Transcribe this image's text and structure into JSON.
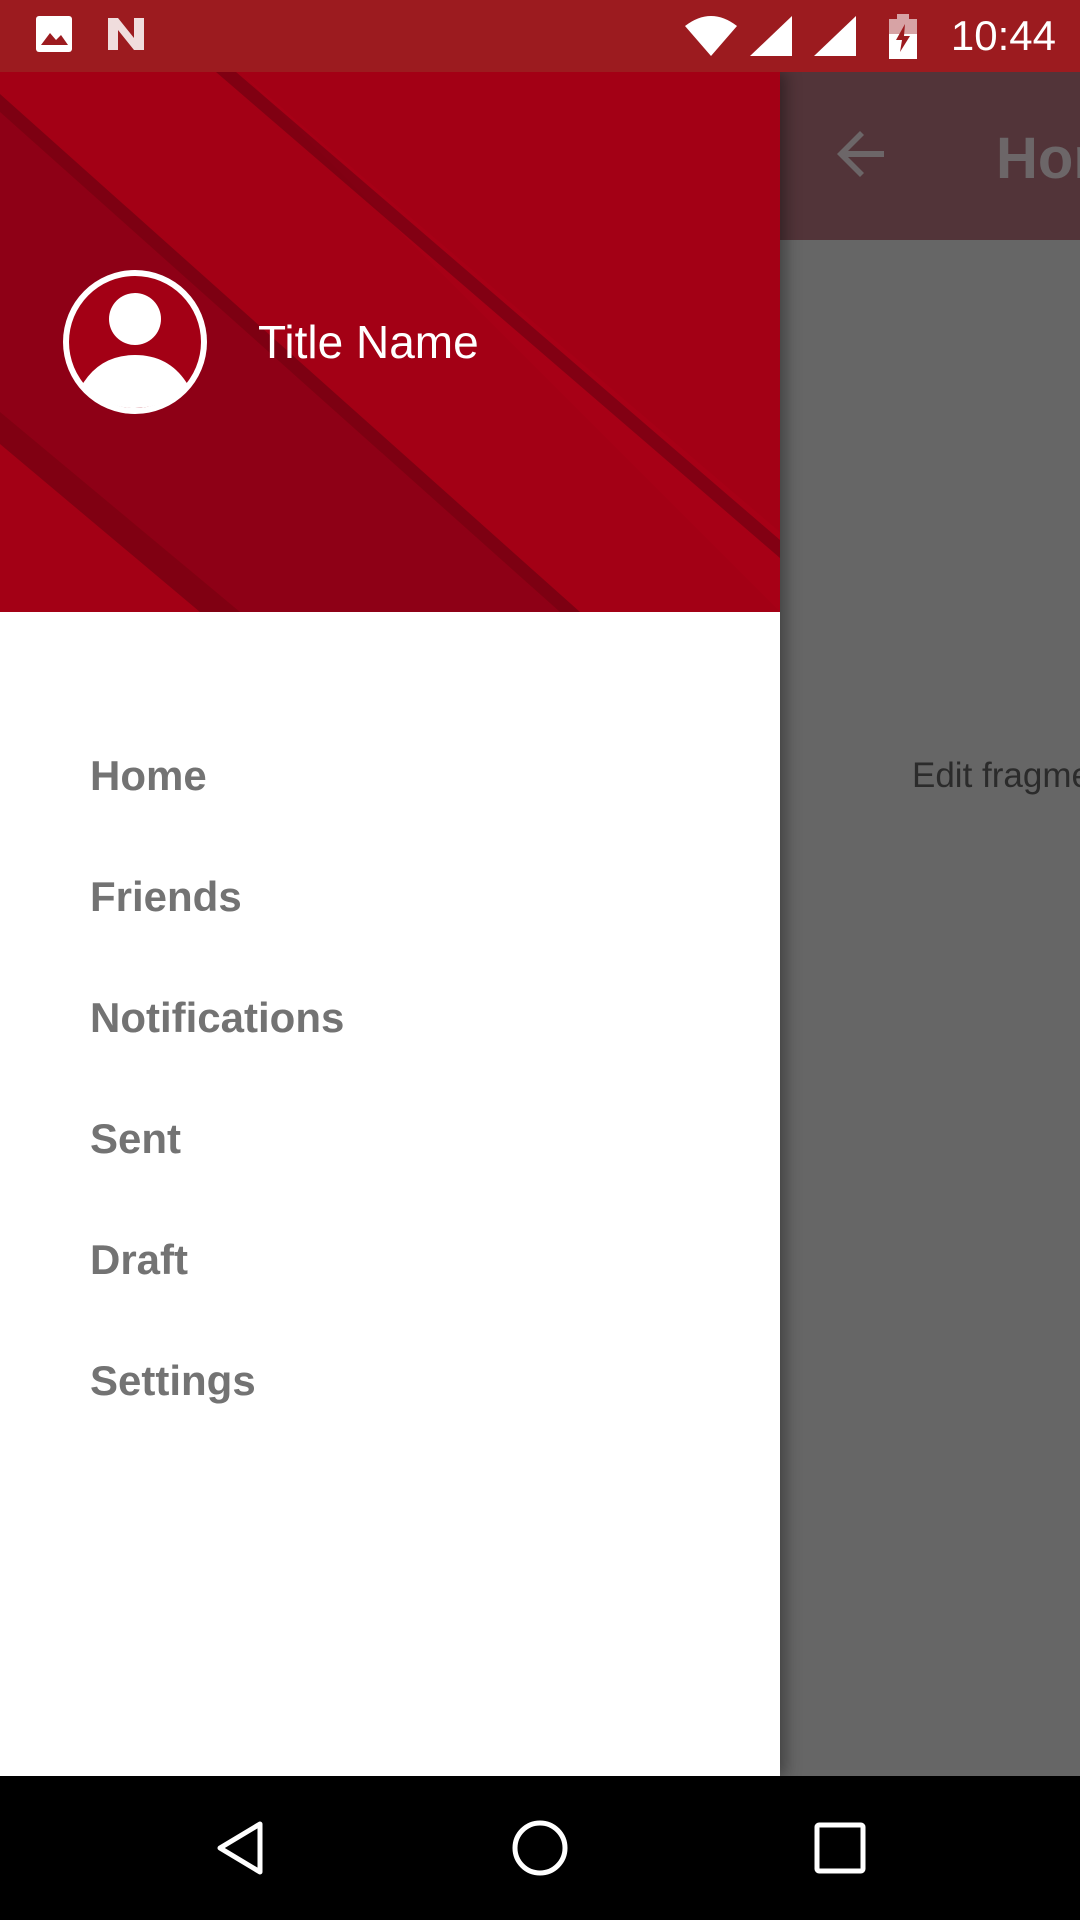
{
  "status_bar": {
    "time": "10:44",
    "icons": [
      "image-icon",
      "n-logo-icon",
      "wifi-icon",
      "signal-icon",
      "signal-icon",
      "battery-charging-icon"
    ]
  },
  "app_bar": {
    "title": "Hor",
    "back_icon": "arrow-back-icon"
  },
  "content": {
    "text": "Edit fragme"
  },
  "drawer": {
    "header": {
      "name": "Title Name",
      "avatar_icon": "account-circle-icon",
      "background_color": "#a30015"
    },
    "items": [
      {
        "label": "Home"
      },
      {
        "label": "Friends"
      },
      {
        "label": "Notifications"
      },
      {
        "label": "Sent"
      },
      {
        "label": "Draft"
      },
      {
        "label": "Settings"
      }
    ]
  },
  "nav_bar": {
    "buttons": [
      "back-icon",
      "home-icon",
      "recents-icon"
    ]
  },
  "colors": {
    "status_bar": "#9c1b1f",
    "drawer_header": "#a30015",
    "menu_text": "#737373",
    "scrim": "#616161"
  }
}
